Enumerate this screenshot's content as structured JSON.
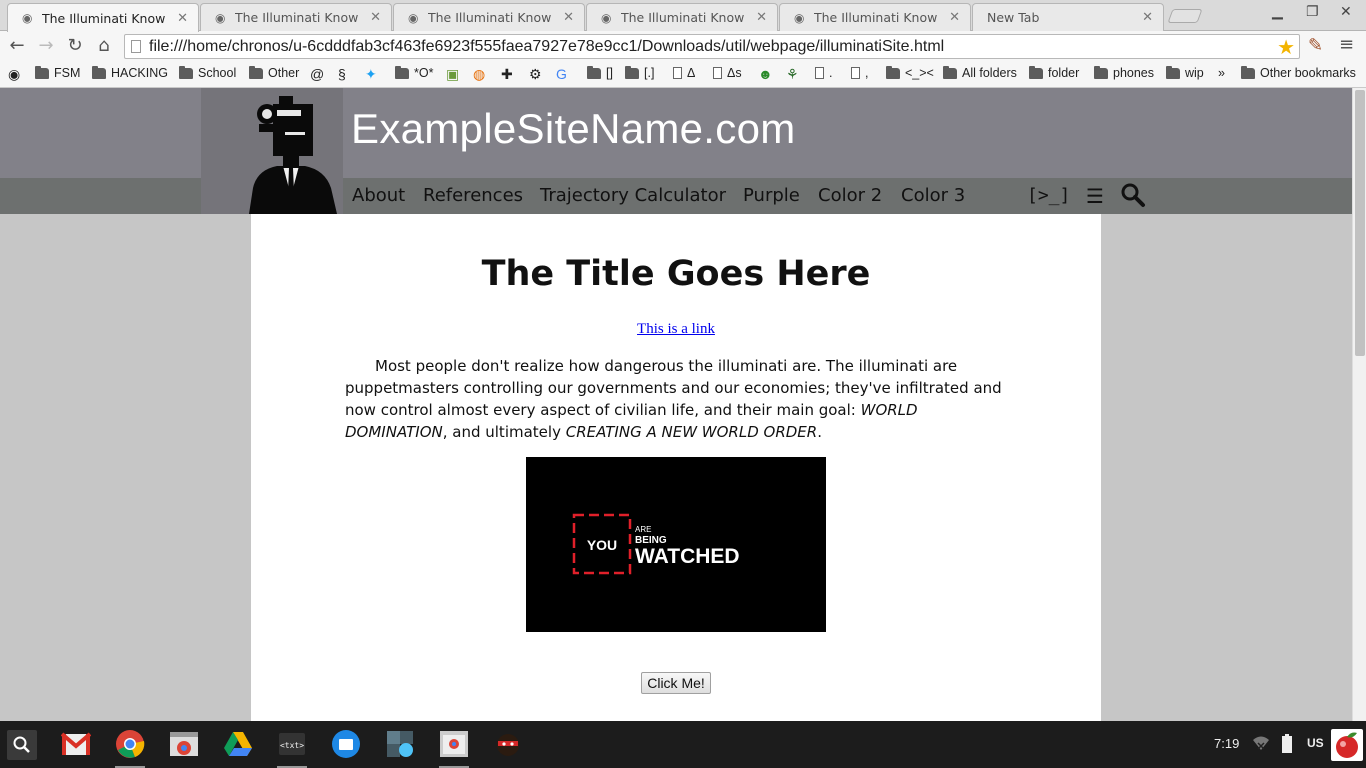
{
  "browser": {
    "tabs": [
      {
        "title": "The Illuminati Know",
        "active": true
      },
      {
        "title": "The Illuminati Know",
        "active": false
      },
      {
        "title": "The Illuminati Know",
        "active": false
      },
      {
        "title": "The Illuminati Know",
        "active": false
      },
      {
        "title": "The Illuminati Know",
        "active": false
      },
      {
        "title": "New Tab",
        "active": false
      }
    ],
    "url": "file:///home/chronos/u-6cdddfab3cf463fe6923f555faea7927e78e9cc1/Downloads/util/webpage/illuminatiSite.html",
    "bookmarks": {
      "fsm": "FSM",
      "hacking": "HACKING",
      "school": "School",
      "other": "Other",
      "o": "*O*",
      "bracket1": "[]",
      "bracket2": "[.]",
      "delta": "Δ",
      "delta_s": "Δs",
      "dot": ".",
      "comma": ",",
      "face": "<_><",
      "all_folders": "All folders",
      "folder": "folder",
      "phones": "phones",
      "wip": "wip",
      "more": "»",
      "other_bookmarks": "Other bookmarks"
    }
  },
  "site": {
    "name": "ExampleSiteName.com",
    "nav": {
      "about": "About",
      "references": "References",
      "trajectory": "Trajectory Calculator",
      "purple": "Purple",
      "color2": "Color 2",
      "color3": "Color 3",
      "terminal": "[>_]",
      "menu": "☰"
    },
    "title": "The Title Goes Here",
    "link": "This is a link",
    "paragraph": {
      "p1": "Most people don't realize how dangerous the illuminati are. The illuminati are puppetmasters controlling our governments and our economies; they've infiltrated and now control almost every aspect of civilian life, and their main goal: ",
      "em1": "WORLD DOMINATION",
      "p2": ", and ultimately ",
      "em2": "CREATING A NEW WORLD ORDER",
      "p3": "."
    },
    "image": {
      "you": "YOU",
      "are": "ARE",
      "being": "BEING",
      "watched": "WATCHED"
    },
    "button": "Click Me!"
  },
  "shelf": {
    "time": "7:19",
    "keyboard": "US"
  },
  "colors": {
    "header_bg": "#828189",
    "nav_bg": "#6d706f",
    "page_bg": "#c6c6c6",
    "watched_red": "#e0202a"
  }
}
